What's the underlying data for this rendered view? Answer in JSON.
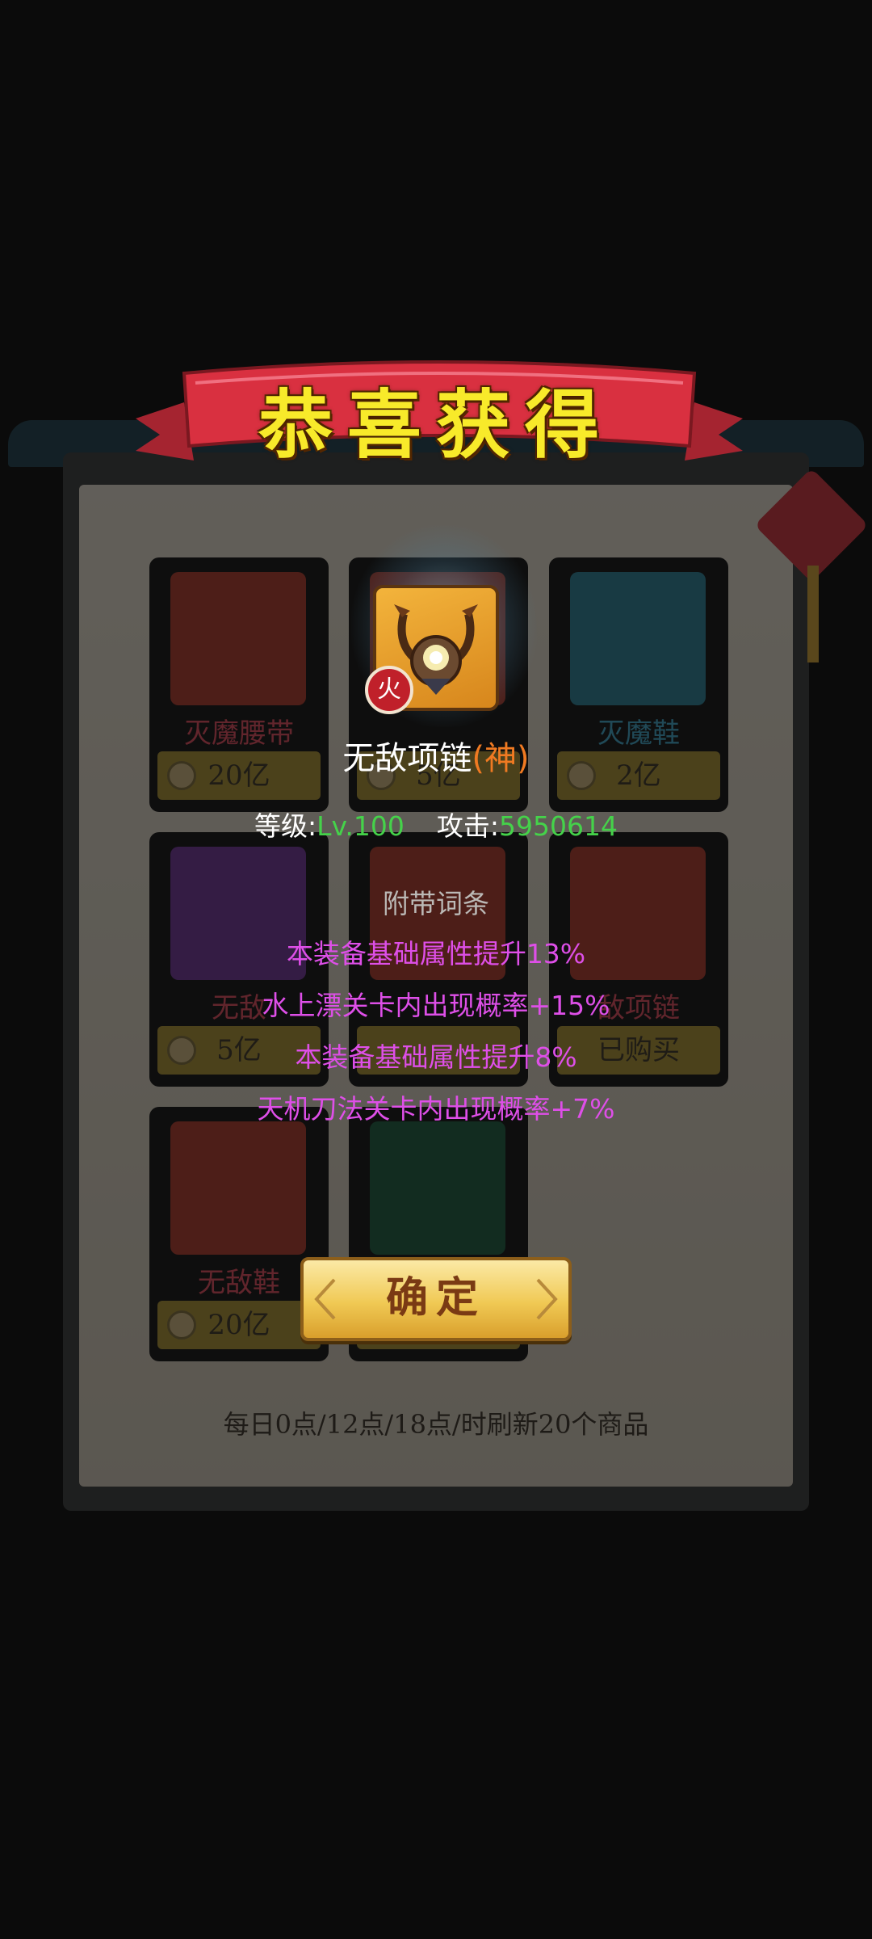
{
  "background_shop": {
    "slots": [
      {
        "name": "灭魔腰带",
        "price": "20亿",
        "art_color": "#a83a2a"
      },
      {
        "name": "",
        "price": "5亿",
        "art_color": "#a83a2a"
      },
      {
        "name": "灭魔鞋",
        "price": "2亿",
        "art_color": "#2b7c92"
      },
      {
        "name": "无敌",
        "price": "5亿",
        "art_color": "#6d3594"
      },
      {
        "name": "",
        "price": "",
        "art_color": "#a83a2a"
      },
      {
        "name": "敌项链",
        "price": "已购买",
        "art_color": "#a83a2a"
      },
      {
        "name": "无敌鞋",
        "price": "20亿",
        "art_color": "#a83a2a"
      },
      {
        "name": "",
        "price": "",
        "art_color": "#1c5a3e"
      }
    ],
    "refresh_note": "每日0点/12点/18点/时刷新20个商品"
  },
  "popup": {
    "title": "恭喜获得",
    "item": {
      "icon": "necklace-icon",
      "element_badge": "火",
      "name": "无敌项链",
      "tier": "(神)"
    },
    "stats": {
      "level_label": "等级:",
      "level_value": "Lv.100",
      "attack_label": "攻击:",
      "attack_value": "5950614"
    },
    "affix_title": "附带词条",
    "affixes": [
      "本装备基础属性提升13%",
      "水上漂关卡内出现概率+15%",
      "本装备基础属性提升8%",
      "天机刀法关卡内出现概率+7%"
    ],
    "confirm_label": "确定"
  },
  "colors": {
    "title_yellow": "#f8ea2a",
    "banner_red": "#d93040",
    "affix_purple": "#de4fe8",
    "stat_green": "#45d24a",
    "tier_orange": "#f07a22"
  }
}
